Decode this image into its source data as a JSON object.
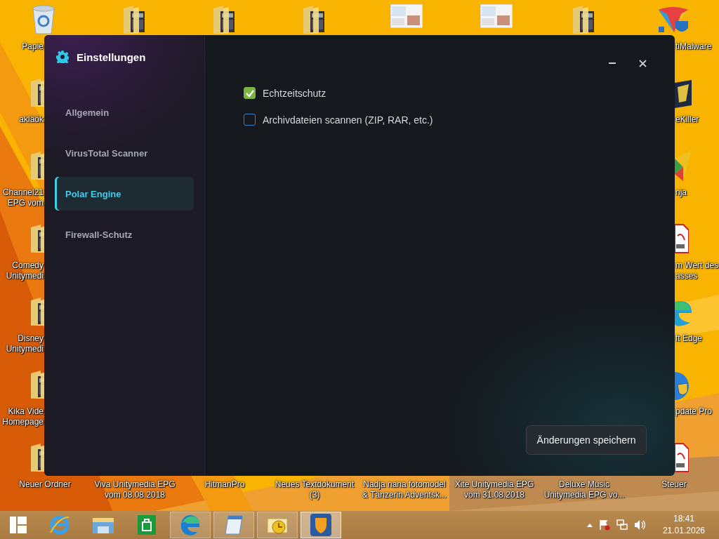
{
  "desktop": {
    "left_column": [
      {
        "kind": "recycle-bin",
        "label": [
          "Papie"
        ]
      },
      {
        "kind": "folder",
        "label": [
          "akläök"
        ]
      },
      {
        "kind": "folder",
        "label": [
          "Channel21",
          "EPG vom"
        ]
      },
      {
        "kind": "folder",
        "label": [
          "Comedy",
          "Unitymedi"
        ]
      },
      {
        "kind": "folder",
        "label": [
          "Disney",
          "Unitymedi"
        ]
      },
      {
        "kind": "folder",
        "label": [
          "Kika Vide",
          "Homepage"
        ]
      },
      {
        "kind": "folder",
        "label": [
          "Neuer Ordner"
        ]
      }
    ],
    "right_column": [
      {
        "kind": "antimalware",
        "label": [
          "tiMalware"
        ]
      },
      {
        "kind": "badge",
        "label": [
          "eKiller"
        ]
      },
      {
        "kind": "triangle",
        "label": [
          "nja"
        ]
      },
      {
        "kind": "pdf",
        "label": [
          "m Wert des",
          "asses"
        ]
      },
      {
        "kind": "edge",
        "label": [
          "ft Edge"
        ]
      },
      {
        "kind": "update",
        "label": [
          "pdate Pro"
        ]
      },
      {
        "kind": "pdf",
        "label": [
          "Steuer"
        ]
      }
    ],
    "top_row": [
      {
        "kind": "folder"
      },
      {
        "kind": "folder"
      },
      {
        "kind": "folder"
      },
      {
        "kind": "thumbnail"
      },
      {
        "kind": "thumbnail"
      },
      {
        "kind": "folder"
      }
    ],
    "bottom_row": [
      {
        "label": [
          "Viva Unitymedia EPG",
          "vom 08.08.2018"
        ]
      },
      {
        "label": [
          "HitmanPro"
        ]
      },
      {
        "label": [
          "Neues Textdokument",
          "(3)"
        ]
      },
      {
        "label": [
          "Nadja nana fotomodel",
          "& Tänzerin Adventsk..."
        ]
      },
      {
        "label": [
          "Xite Unitymedia EPG",
          "vom 31.08.2018"
        ]
      },
      {
        "label": [
          "Deluxe Music",
          "Unitymedia EPG vo..."
        ]
      }
    ]
  },
  "window": {
    "title": "Einstellungen",
    "nav": [
      {
        "label": "Allgemein",
        "selected": false
      },
      {
        "label": "VirusTotal Scanner",
        "selected": false
      },
      {
        "label": "Polar Engine",
        "selected": true
      },
      {
        "label": "Firewall-Schutz",
        "selected": false
      }
    ],
    "options": [
      {
        "label": "Echtzeitschutz",
        "checked": true
      },
      {
        "label": "Archivdateien scannen (ZIP, RAR, etc.)",
        "checked": false
      }
    ],
    "save_button": "Änderungen speichern"
  },
  "taskbar": {
    "apps": [
      {
        "kind": "ie",
        "running": false,
        "selected": false
      },
      {
        "kind": "explorer",
        "running": false,
        "selected": false
      },
      {
        "kind": "store",
        "running": false,
        "selected": false
      },
      {
        "kind": "edge",
        "running": true,
        "selected": false
      },
      {
        "kind": "notepad",
        "running": true,
        "selected": false
      },
      {
        "kind": "outlook",
        "running": true,
        "selected": false
      },
      {
        "kind": "shield",
        "running": true,
        "selected": true
      }
    ],
    "time": "18:41",
    "date": "21.01.2026"
  }
}
